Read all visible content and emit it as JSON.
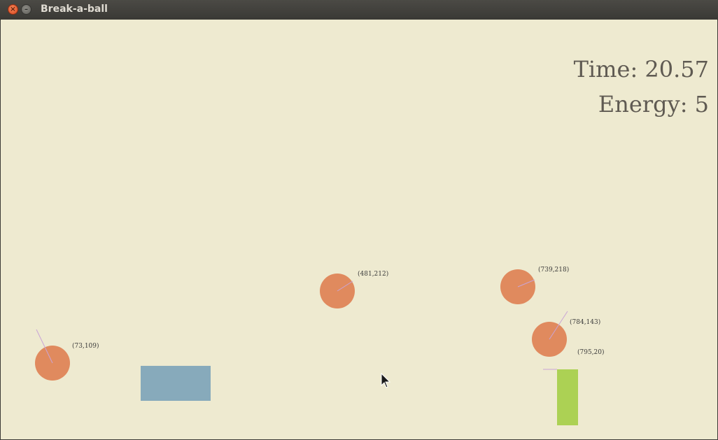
{
  "window": {
    "title": "Break-a-ball",
    "controls": {
      "close_icon": "close-icon",
      "minimize_icon": "minimize-icon"
    }
  },
  "hud": {
    "time": "Time: 20.57",
    "energy": "Energy: 5"
  },
  "colors": {
    "background": "#eeead0",
    "ball": "#e08a5e",
    "heading_line": "#c9a4d6",
    "block": "#87aabb",
    "paddle": "#acd154"
  },
  "balls": [
    {
      "coord_label": "(73,109)"
    },
    {
      "coord_label": "(481,212)"
    },
    {
      "coord_label": "(739,218)"
    },
    {
      "coord_label": "(784,143)"
    }
  ],
  "paddle": {
    "coord_label": "(795,20)"
  },
  "cursor": "arrow-cursor-icon"
}
